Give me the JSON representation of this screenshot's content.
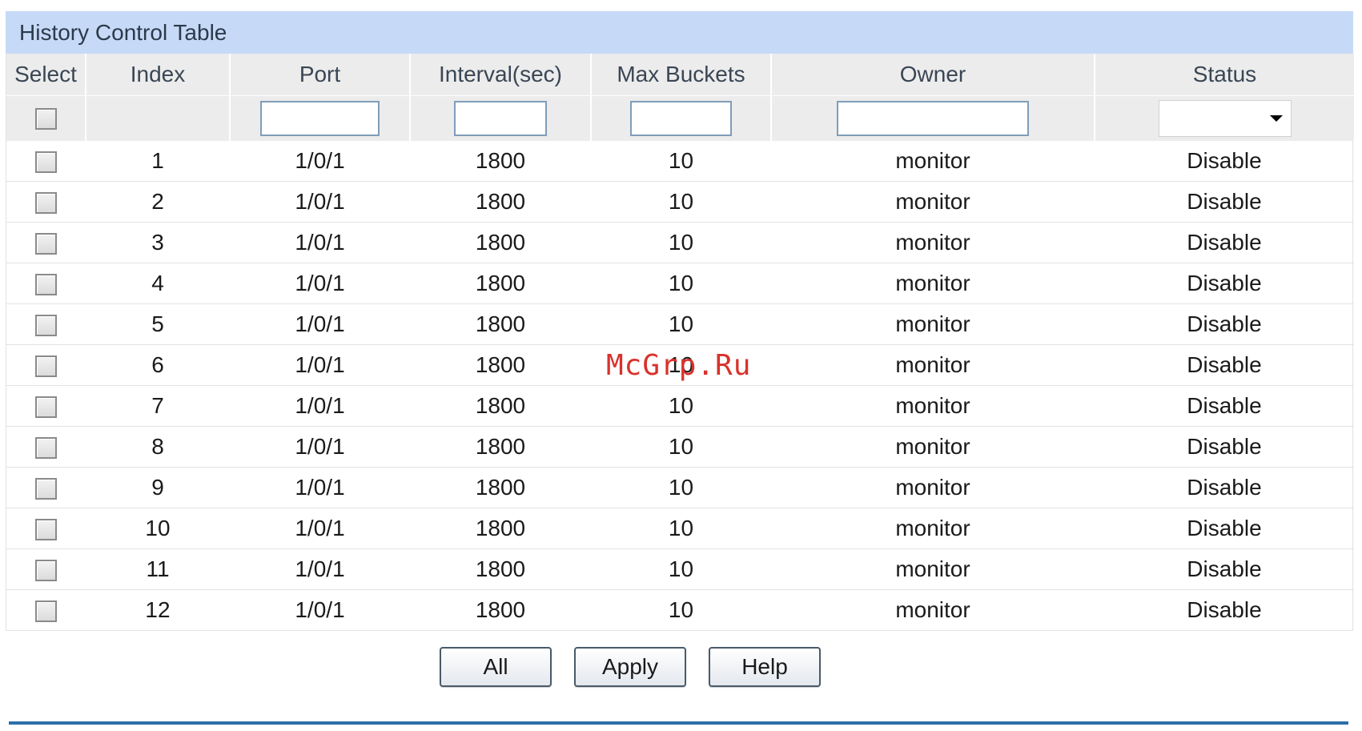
{
  "table_title": "History Control Table",
  "columns": [
    "Select",
    "Index",
    "Port",
    "Interval(sec)",
    "Max Buckets",
    "Owner",
    "Status"
  ],
  "filter": {
    "port_value": "",
    "interval_value": "",
    "max_buckets_value": "",
    "owner_value": "",
    "status_selected": ""
  },
  "rows": [
    {
      "index": "1",
      "port": "1/0/1",
      "interval": "1800",
      "max_buckets": "10",
      "owner": "monitor",
      "status": "Disable"
    },
    {
      "index": "2",
      "port": "1/0/1",
      "interval": "1800",
      "max_buckets": "10",
      "owner": "monitor",
      "status": "Disable"
    },
    {
      "index": "3",
      "port": "1/0/1",
      "interval": "1800",
      "max_buckets": "10",
      "owner": "monitor",
      "status": "Disable"
    },
    {
      "index": "4",
      "port": "1/0/1",
      "interval": "1800",
      "max_buckets": "10",
      "owner": "monitor",
      "status": "Disable"
    },
    {
      "index": "5",
      "port": "1/0/1",
      "interval": "1800",
      "max_buckets": "10",
      "owner": "monitor",
      "status": "Disable"
    },
    {
      "index": "6",
      "port": "1/0/1",
      "interval": "1800",
      "max_buckets": "10",
      "owner": "monitor",
      "status": "Disable"
    },
    {
      "index": "7",
      "port": "1/0/1",
      "interval": "1800",
      "max_buckets": "10",
      "owner": "monitor",
      "status": "Disable"
    },
    {
      "index": "8",
      "port": "1/0/1",
      "interval": "1800",
      "max_buckets": "10",
      "owner": "monitor",
      "status": "Disable"
    },
    {
      "index": "9",
      "port": "1/0/1",
      "interval": "1800",
      "max_buckets": "10",
      "owner": "monitor",
      "status": "Disable"
    },
    {
      "index": "10",
      "port": "1/0/1",
      "interval": "1800",
      "max_buckets": "10",
      "owner": "monitor",
      "status": "Disable"
    },
    {
      "index": "11",
      "port": "1/0/1",
      "interval": "1800",
      "max_buckets": "10",
      "owner": "monitor",
      "status": "Disable"
    },
    {
      "index": "12",
      "port": "1/0/1",
      "interval": "1800",
      "max_buckets": "10",
      "owner": "monitor",
      "status": "Disable"
    }
  ],
  "buttons": {
    "all": "All",
    "apply": "Apply",
    "help": "Help"
  },
  "watermark": "McGrp.Ru",
  "colors": {
    "title_bar": "#c6d9f7",
    "header_bg": "#ececec",
    "rule": "#2d6fa8",
    "watermark": "#d8322b"
  },
  "icons": {
    "status_dropdown": "chevron-down-icon"
  }
}
